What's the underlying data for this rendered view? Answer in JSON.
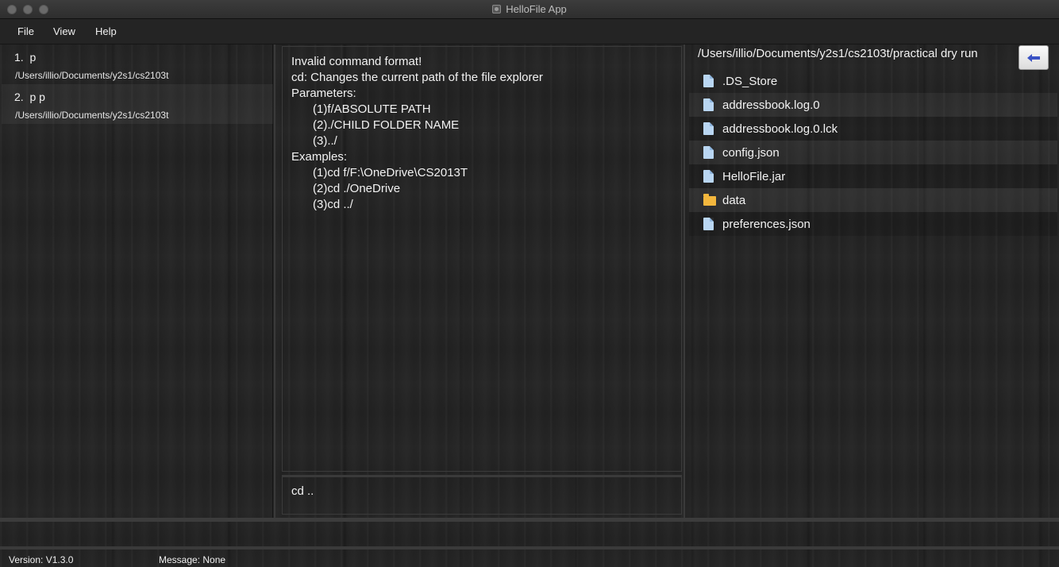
{
  "window": {
    "title": "HelloFile App"
  },
  "menu": {
    "file": "File",
    "view": "View",
    "help": "Help"
  },
  "people": [
    {
      "index": "1.",
      "name": "p",
      "path": "/Users/illio/Documents/y2s1/cs2103t"
    },
    {
      "index": "2.",
      "name": "p p",
      "path": "/Users/illio/Documents/y2s1/cs2103t"
    }
  ],
  "result": {
    "lines": [
      "Invalid command format!",
      "cd: Changes the current path of the file explorer",
      "",
      "Parameters:",
      "(1)f/ABSOLUTE PATH",
      "(2)./CHILD FOLDER NAME",
      "(3)../",
      "",
      "Examples:",
      "(1)cd f/F:\\OneDrive\\CS2013T",
      "(2)cd ./OneDrive",
      "(3)cd ../"
    ]
  },
  "command": {
    "value": "cd .."
  },
  "explorer": {
    "current_path": "/Users/illio/Documents/y2s1/cs2103t/practical dry run",
    "back_icon": "arrow-left-icon",
    "files": [
      {
        "name": ".DS_Store",
        "type": "file"
      },
      {
        "name": "addressbook.log.0",
        "type": "file"
      },
      {
        "name": "addressbook.log.0.lck",
        "type": "file"
      },
      {
        "name": "config.json",
        "type": "file"
      },
      {
        "name": "HelloFile.jar",
        "type": "file"
      },
      {
        "name": "data",
        "type": "folder"
      },
      {
        "name": "preferences.json",
        "type": "file"
      }
    ]
  },
  "status": {
    "version": "Version: V1.3.0",
    "message": "Message: None"
  },
  "colors": {
    "background": "#232323",
    "folder": "#f3b73d",
    "file": "#b9d6f2",
    "back_arrow": "#3a52c4"
  }
}
